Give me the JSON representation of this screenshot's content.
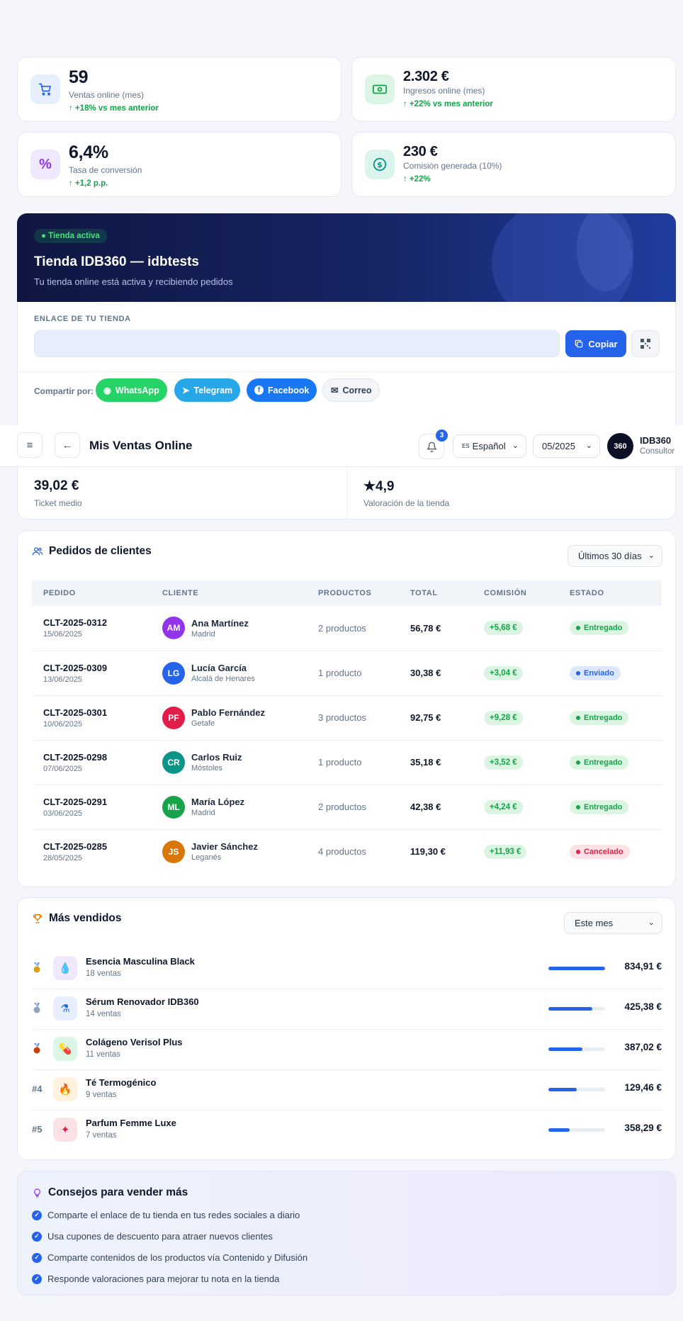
{
  "stats": [
    {
      "value": "59",
      "label": "Ventas online (mes)",
      "trend": "+18% vs mes anterior",
      "icon": "cart-icon"
    },
    {
      "value": "2.302 €",
      "label": "Ingresos online (mes)",
      "trend": "+22% vs mes anterior",
      "icon": "money-icon"
    },
    {
      "value": "6,4%",
      "label": "Tasa de conversión",
      "trend": "+1,2 p.p.",
      "icon": "percent-icon"
    },
    {
      "value": "230 €",
      "label": "Comisión generada (10%)",
      "trend": "+22%",
      "icon": "coin-icon"
    }
  ],
  "store": {
    "badge": "Tienda activa",
    "title": "Tienda IDB360 — idbtests",
    "subtitle": "Tu tienda online está activa y recibiendo pedidos",
    "link_caption": "ENLACE DE TU TIENDA",
    "link_value": "",
    "copy_label": "Copiar",
    "share_label": "Compartir por:",
    "share": {
      "whatsapp": "WhatsApp",
      "telegram": "Telegram",
      "facebook": "Facebook",
      "email": "Correo"
    }
  },
  "topbar": {
    "title": "Mis Ventas Online",
    "notifications": "3",
    "language": "Español",
    "language_flag": "ES",
    "period": "05/2025",
    "avatar": "360",
    "user_name": "IDB360",
    "user_role": "Consultor"
  },
  "metrics": {
    "ticket_value": "39,02 €",
    "ticket_label": "Ticket medio",
    "rating_value": "4,9",
    "rating_label": "Valoración de la tienda"
  },
  "orders": {
    "title": "Pedidos de clientes",
    "filter": "Últimos 30 días",
    "columns": [
      "PEDIDO",
      "CLIENTE",
      "PRODUCTOS",
      "TOTAL",
      "COMISIÓN",
      "ESTADO"
    ],
    "rows": [
      {
        "id": "CLT-2025-0312",
        "date": "15/06/2025",
        "initials": "AM",
        "name": "Ana Martínez",
        "city": "Madrid",
        "products": "2 productos",
        "total": "56,78 €",
        "commission": "+5,68 €",
        "status": "Entregado"
      },
      {
        "id": "CLT-2025-0309",
        "date": "13/06/2025",
        "initials": "LG",
        "name": "Lucía García",
        "city": "Alcalá de Henares",
        "products": "1 producto",
        "total": "30,38 €",
        "commission": "+3,04 €",
        "status": "Enviado"
      },
      {
        "id": "CLT-2025-0301",
        "date": "10/06/2025",
        "initials": "PF",
        "name": "Pablo Fernández",
        "city": "Getafe",
        "products": "3 productos",
        "total": "92,75 €",
        "commission": "+9,28 €",
        "status": "Entregado"
      },
      {
        "id": "CLT-2025-0298",
        "date": "07/06/2025",
        "initials": "CR",
        "name": "Carlos Ruiz",
        "city": "Móstoles",
        "products": "1 producto",
        "total": "35,18 €",
        "commission": "+3,52 €",
        "status": "Entregado"
      },
      {
        "id": "CLT-2025-0291",
        "date": "03/06/2025",
        "initials": "ML",
        "name": "María López",
        "city": "Madrid",
        "products": "2 productos",
        "total": "42,38 €",
        "commission": "+4,24 €",
        "status": "Entregado"
      },
      {
        "id": "CLT-2025-0285",
        "date": "28/05/2025",
        "initials": "JS",
        "name": "Javier Sánchez",
        "city": "Leganés",
        "products": "4 productos",
        "total": "119,30 €",
        "commission": "+11,93 €",
        "status": "Cancelado"
      }
    ]
  },
  "bestsellers": {
    "title": "Más vendidos",
    "filter": "Este mes",
    "items": [
      {
        "rank": "",
        "medal": "gold-medal-icon",
        "name": "Esencia Masculina Black",
        "sales": "18 ventas",
        "amount": "834,91 €",
        "share": 1.0,
        "icon": "drop-icon"
      },
      {
        "rank": "",
        "medal": "silver-medal-icon",
        "name": "Sérum Renovador IDB360",
        "sales": "14 ventas",
        "amount": "425,38 €",
        "share": 0.78,
        "icon": "serum-icon"
      },
      {
        "rank": "",
        "medal": "bronze-medal-icon",
        "name": "Colágeno Verisol Plus",
        "sales": "11 ventas",
        "amount": "387,02 €",
        "share": 0.6,
        "icon": "capsule-icon"
      },
      {
        "rank": "#4",
        "medal": "",
        "name": "Té Termogénico",
        "sales": "9 ventas",
        "amount": "129,46 €",
        "share": 0.5,
        "icon": "flame-icon"
      },
      {
        "rank": "#5",
        "medal": "",
        "name": "Parfum Femme Luxe",
        "sales": "7 ventas",
        "amount": "358,29 €",
        "share": 0.38,
        "icon": "sparkle-icon"
      }
    ]
  },
  "tips": {
    "title": "Consejos para vender más",
    "items": [
      "Comparte el enlace de tu tienda en tus redes sociales a diario",
      "Usa cupones de descuento para atraer nuevos clientes",
      "Comparte contenidos de los productos vía Contenido y Difusión",
      "Responde valoraciones para mejorar tu nota en la tienda"
    ]
  },
  "colors": {
    "accent": "#2563eb",
    "success": "#16a34a",
    "hero": "#0f1640",
    "whatsapp": "#25d366",
    "telegram": "#27a7e7",
    "facebook": "#1877f2"
  }
}
